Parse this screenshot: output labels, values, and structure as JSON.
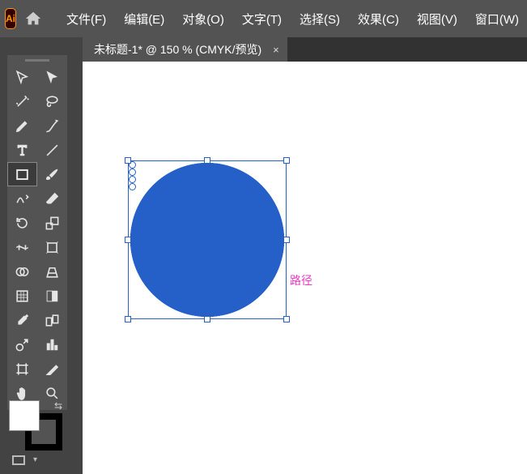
{
  "menubar": {
    "items": [
      "文件(F)",
      "编辑(E)",
      "对象(O)",
      "文字(T)",
      "选择(S)",
      "效果(C)",
      "视图(V)",
      "窗口(W)"
    ]
  },
  "tab": {
    "title": "未标题-1* @ 150 % (CMYK/预览)",
    "close": "×"
  },
  "canvas": {
    "path_label": "路径"
  },
  "tools": [
    {
      "name": "selection-tool",
      "icon": "cursor"
    },
    {
      "name": "direct-selection-tool",
      "icon": "cursor-solid"
    },
    {
      "name": "magic-wand-tool",
      "icon": "wand"
    },
    {
      "name": "lasso-tool",
      "icon": "lasso"
    },
    {
      "name": "pen-tool",
      "icon": "pen"
    },
    {
      "name": "curvature-tool",
      "icon": "curve-pen"
    },
    {
      "name": "type-tool",
      "icon": "type"
    },
    {
      "name": "line-segment-tool",
      "icon": "line"
    },
    {
      "name": "rectangle-tool",
      "icon": "rect",
      "selected": true
    },
    {
      "name": "paintbrush-tool",
      "icon": "brush"
    },
    {
      "name": "shaper-tool",
      "icon": "shaper"
    },
    {
      "name": "eraser-tool",
      "icon": "eraser"
    },
    {
      "name": "rotate-tool",
      "icon": "rotate"
    },
    {
      "name": "scale-tool",
      "icon": "scale"
    },
    {
      "name": "width-tool",
      "icon": "width"
    },
    {
      "name": "free-transform-tool",
      "icon": "transform"
    },
    {
      "name": "shape-builder-tool",
      "icon": "shape-builder"
    },
    {
      "name": "perspective-grid-tool",
      "icon": "perspective"
    },
    {
      "name": "mesh-tool",
      "icon": "mesh"
    },
    {
      "name": "gradient-tool",
      "icon": "gradient"
    },
    {
      "name": "eyedropper-tool",
      "icon": "eyedropper"
    },
    {
      "name": "blend-tool",
      "icon": "blend"
    },
    {
      "name": "symbol-sprayer-tool",
      "icon": "spray"
    },
    {
      "name": "column-graph-tool",
      "icon": "graph"
    },
    {
      "name": "artboard-tool",
      "icon": "artboard"
    },
    {
      "name": "slice-tool",
      "icon": "slice"
    },
    {
      "name": "hand-tool",
      "icon": "hand"
    },
    {
      "name": "zoom-tool",
      "icon": "zoom"
    }
  ]
}
